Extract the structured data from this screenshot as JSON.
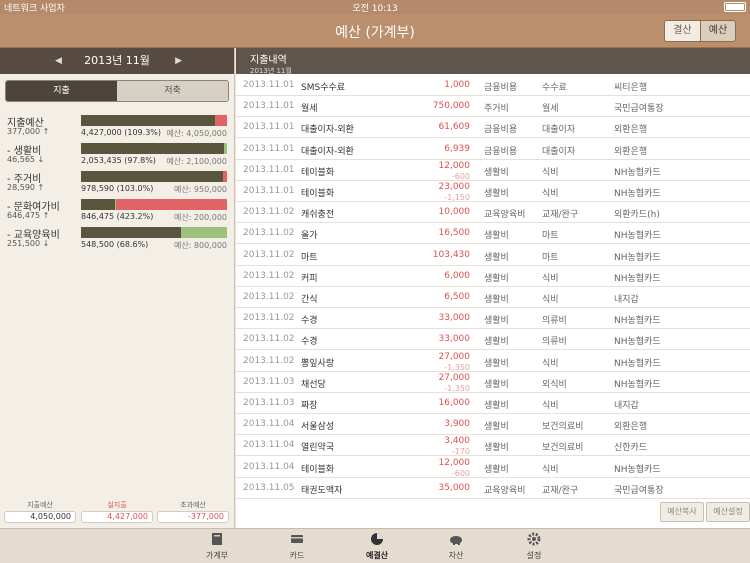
{
  "status": {
    "carrier": "네트워크 사업자",
    "time": "오전 10:13"
  },
  "nav": {
    "title": "예산 (가계부)",
    "seg_left": "결산",
    "seg_right": "예산"
  },
  "left": {
    "month": "2013년 11월",
    "tab_expense": "지출",
    "tab_saving": "저축",
    "budgets": [
      {
        "name": "지출예산",
        "sub": "377,000 ↑",
        "stat": "4,427,000 (109.3%)",
        "limit": "예산: 4,050,000",
        "ratio": 1.093
      },
      {
        "name": "- 생활비",
        "sub": "46,565 ↓",
        "stat": "2,053,435 (97.8%)",
        "limit": "예산: 2,100,000",
        "ratio": 0.978
      },
      {
        "name": "- 주거비",
        "sub": "28,590 ↑",
        "stat": "978,590 (103.0%)",
        "limit": "예산: 950,000",
        "ratio": 1.03
      },
      {
        "name": "- 문화여가비",
        "sub": "646,475 ↑",
        "stat": "846,475 (423.2%)",
        "limit": "예산: 200,000",
        "ratio": 4.232
      },
      {
        "name": "- 교육양육비",
        "sub": "251,500 ↓",
        "stat": "548,500 (68.6%)",
        "limit": "예산: 800,000",
        "ratio": 0.686
      }
    ],
    "totals": [
      {
        "label": "지출예산",
        "value": "4,050,000"
      },
      {
        "label": "실지출",
        "value": "4,427,000"
      },
      {
        "label": "초과예산",
        "value": "-377,000"
      }
    ]
  },
  "right": {
    "header_title": "지출내역",
    "header_sub": "2013년 11월",
    "rows": [
      {
        "date": "2013.11.01",
        "item": "SMS수수료",
        "amount": "1,000",
        "cat": "금융비용",
        "sub": "수수료",
        "pay": "씨티은행"
      },
      {
        "date": "2013.11.01",
        "item": "월세",
        "amount": "750,000",
        "cat": "주거비",
        "sub": "월세",
        "pay": "국민급여통장"
      },
      {
        "date": "2013.11.01",
        "item": "대출이자-외환",
        "amount": "61,609",
        "cat": "금융비용",
        "sub": "대출이자",
        "pay": "외환은행"
      },
      {
        "date": "2013.11.01",
        "item": "대출이자-외환",
        "amount": "6,939",
        "cat": "금융비용",
        "sub": "대출이자",
        "pay": "외환은행"
      },
      {
        "date": "2013.11.01",
        "item": "테이블화",
        "amount": "12,000",
        "amount2": "-600",
        "cat": "생활비",
        "sub": "식비",
        "pay": "NH농협카드"
      },
      {
        "date": "2013.11.01",
        "item": "테이블화",
        "amount": "23,000",
        "amount2": "-1,150",
        "cat": "생활비",
        "sub": "식비",
        "pay": "NH농협카드"
      },
      {
        "date": "2013.11.02",
        "item": "캐쉬충전",
        "amount": "10,000",
        "cat": "교육양육비",
        "sub": "교재/완구",
        "pay": "외환카드(h)"
      },
      {
        "date": "2013.11.02",
        "item": "올가",
        "amount": "16,500",
        "cat": "생활비",
        "sub": "마트",
        "pay": "NH농협카드"
      },
      {
        "date": "2013.11.02",
        "item": "마트",
        "amount": "103,430",
        "cat": "생활비",
        "sub": "마트",
        "pay": "NH농협카드"
      },
      {
        "date": "2013.11.02",
        "item": "커피",
        "amount": "6,000",
        "cat": "생활비",
        "sub": "식비",
        "pay": "NH농협카드"
      },
      {
        "date": "2013.11.02",
        "item": "간식",
        "amount": "6,500",
        "cat": "생활비",
        "sub": "식비",
        "pay": "내지갑"
      },
      {
        "date": "2013.11.02",
        "item": "수경",
        "amount": "33,000",
        "cat": "생활비",
        "sub": "의류비",
        "pay": "NH농협카드"
      },
      {
        "date": "2013.11.02",
        "item": "수경",
        "amount": "33,000",
        "cat": "생활비",
        "sub": "의류비",
        "pay": "NH농협카드"
      },
      {
        "date": "2013.11.02",
        "item": "뽕잎사랑",
        "amount": "27,000",
        "amount2": "-1,350",
        "cat": "생활비",
        "sub": "식비",
        "pay": "NH농협카드"
      },
      {
        "date": "2013.11.03",
        "item": "채선당",
        "amount": "27,000",
        "amount2": "-1,350",
        "cat": "생활비",
        "sub": "외식비",
        "pay": "NH농협카드"
      },
      {
        "date": "2013.11.03",
        "item": "짜장",
        "amount": "16,000",
        "cat": "생활비",
        "sub": "식비",
        "pay": "내지갑"
      },
      {
        "date": "2013.11.04",
        "item": "서울삼성",
        "amount": "3,900",
        "cat": "생활비",
        "sub": "보건의료비",
        "pay": "외환은행"
      },
      {
        "date": "2013.11.04",
        "item": "열린약국",
        "amount": "3,400",
        "amount2": "-170",
        "cat": "생활비",
        "sub": "보건의료비",
        "pay": "신한카드"
      },
      {
        "date": "2013.11.04",
        "item": "테이블화",
        "amount": "12,000",
        "amount2": "-600",
        "cat": "생활비",
        "sub": "식비",
        "pay": "NH농협카드"
      },
      {
        "date": "2013.11.05",
        "item": "태권도액자",
        "amount": "35,000",
        "cat": "교육양육비",
        "sub": "교재/완구",
        "pay": "국민급여통장"
      }
    ],
    "btn_copy": "예산복사",
    "btn_setting": "예산설정"
  },
  "tabbar": [
    {
      "label": "가계부",
      "icon": "book-icon"
    },
    {
      "label": "카드",
      "icon": "card-icon"
    },
    {
      "label": "예결산",
      "icon": "pie-chart-icon"
    },
    {
      "label": "자산",
      "icon": "piggy-bank-icon"
    },
    {
      "label": "설정",
      "icon": "gear-icon"
    }
  ],
  "colors": {
    "brand": "#bb8e6c",
    "under": "#5a553e",
    "over": "#e06464",
    "remaining": "#9cc17c",
    "amount": "#e05050"
  }
}
